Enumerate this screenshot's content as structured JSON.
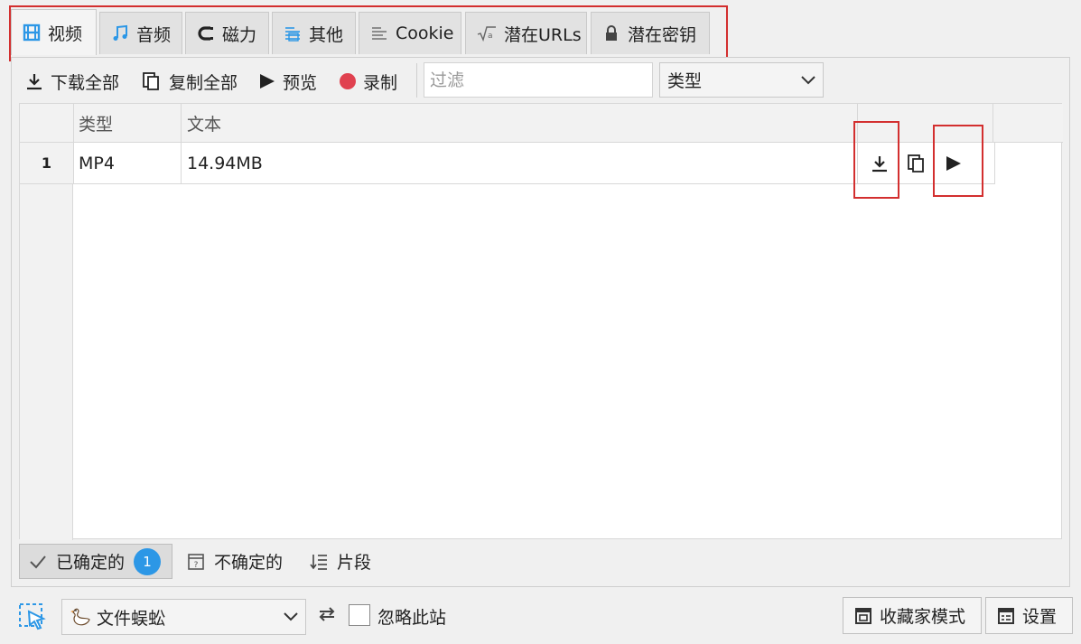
{
  "tabs": [
    {
      "label": "视频",
      "icon": "film-icon"
    },
    {
      "label": "音频",
      "icon": "music-note-icon"
    },
    {
      "label": "磁力",
      "icon": "magnet-icon"
    },
    {
      "label": "其他",
      "icon": "list-icon"
    },
    {
      "label": "Cookie",
      "icon": "text-lines-icon"
    },
    {
      "label": "潜在URLs",
      "icon": "sqrt-icon"
    },
    {
      "label": "潜在密钥",
      "icon": "lock-icon"
    }
  ],
  "toolbar": {
    "download_all": "下载全部",
    "copy_all": "复制全部",
    "preview": "预览",
    "record": "录制",
    "filter_placeholder": "过滤",
    "type_select": "类型"
  },
  "table": {
    "headers": [
      "类型",
      "文本"
    ],
    "rows": [
      {
        "index": "1",
        "type": "MP4",
        "text": "14.94MB"
      }
    ]
  },
  "bottom_tabs": {
    "confirmed": "已确定的",
    "confirmed_count": "1",
    "uncertain": "不确定的",
    "segments": "片段"
  },
  "footer": {
    "spider_select": "文件蜈蚣",
    "ignore_site": "忽略此站",
    "favorites_mode": "收藏家模式",
    "settings": "设置"
  },
  "colors": {
    "accent_blue": "#2c97e6",
    "record_red": "#e0414f",
    "highlight_red": "#d32f2f"
  }
}
